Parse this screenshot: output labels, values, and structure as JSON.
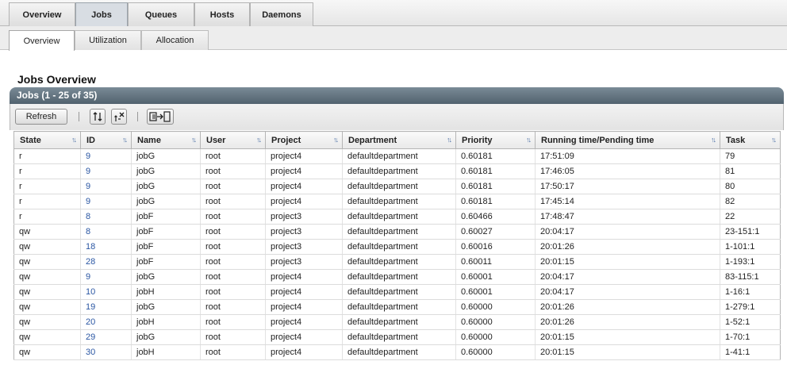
{
  "top_tabs": [
    {
      "label": "Overview",
      "active": false
    },
    {
      "label": "Jobs",
      "active": true
    },
    {
      "label": "Queues",
      "active": false
    },
    {
      "label": "Hosts",
      "active": false
    },
    {
      "label": "Daemons",
      "active": false
    }
  ],
  "sub_tabs": [
    {
      "label": "Overview",
      "active": true
    },
    {
      "label": "Utilization",
      "active": false
    },
    {
      "label": "Allocation",
      "active": false
    }
  ],
  "page_title": "Jobs Overview",
  "panel_title": "Jobs (1 - 25 of 35)",
  "toolbar": {
    "refresh_label": "Refresh",
    "icons": [
      "sort-columns-icon",
      "clear-sort-icon",
      "export-icon"
    ]
  },
  "table": {
    "columns": [
      "State",
      "ID",
      "Name",
      "User",
      "Project",
      "Department",
      "Priority",
      "Running time/Pending time",
      "Task"
    ],
    "rows": [
      [
        "r",
        "9",
        "jobG",
        "root",
        "project4",
        "defaultdepartment",
        "0.60181",
        "17:51:09",
        "79"
      ],
      [
        "r",
        "9",
        "jobG",
        "root",
        "project4",
        "defaultdepartment",
        "0.60181",
        "17:46:05",
        "81"
      ],
      [
        "r",
        "9",
        "jobG",
        "root",
        "project4",
        "defaultdepartment",
        "0.60181",
        "17:50:17",
        "80"
      ],
      [
        "r",
        "9",
        "jobG",
        "root",
        "project4",
        "defaultdepartment",
        "0.60181",
        "17:45:14",
        "82"
      ],
      [
        "r",
        "8",
        "jobF",
        "root",
        "project3",
        "defaultdepartment",
        "0.60466",
        "17:48:47",
        "22"
      ],
      [
        "qw",
        "8",
        "jobF",
        "root",
        "project3",
        "defaultdepartment",
        "0.60027",
        "20:04:17",
        "23-151:1"
      ],
      [
        "qw",
        "18",
        "jobF",
        "root",
        "project3",
        "defaultdepartment",
        "0.60016",
        "20:01:26",
        "1-101:1"
      ],
      [
        "qw",
        "28",
        "jobF",
        "root",
        "project3",
        "defaultdepartment",
        "0.60011",
        "20:01:15",
        "1-193:1"
      ],
      [
        "qw",
        "9",
        "jobG",
        "root",
        "project4",
        "defaultdepartment",
        "0.60001",
        "20:04:17",
        "83-115:1"
      ],
      [
        "qw",
        "10",
        "jobH",
        "root",
        "project4",
        "defaultdepartment",
        "0.60001",
        "20:04:17",
        "1-16:1"
      ],
      [
        "qw",
        "19",
        "jobG",
        "root",
        "project4",
        "defaultdepartment",
        "0.60000",
        "20:01:26",
        "1-279:1"
      ],
      [
        "qw",
        "20",
        "jobH",
        "root",
        "project4",
        "defaultdepartment",
        "0.60000",
        "20:01:26",
        "1-52:1"
      ],
      [
        "qw",
        "29",
        "jobG",
        "root",
        "project4",
        "defaultdepartment",
        "0.60000",
        "20:01:15",
        "1-70:1"
      ],
      [
        "qw",
        "30",
        "jobH",
        "root",
        "project4",
        "defaultdepartment",
        "0.60000",
        "20:01:15",
        "1-41:1"
      ]
    ]
  }
}
